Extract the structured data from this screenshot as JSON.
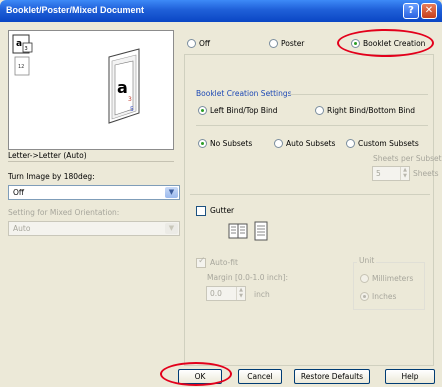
{
  "window": {
    "title": "Booklet/Poster/Mixed Document",
    "help_icon": "?",
    "close_icon": "✕"
  },
  "preview": {
    "caption": "Letter->Letter (Auto)"
  },
  "rotate": {
    "label": "Turn Image by 180deg:",
    "value": "Off"
  },
  "mixed": {
    "label": "Setting for Mixed Orientation:",
    "value": "Auto"
  },
  "mode": {
    "off": "Off",
    "poster": "Poster",
    "booklet": "Booklet Creation",
    "selected": "Booklet Creation"
  },
  "booklet": {
    "group_label": "Booklet Creation Settings",
    "bind_left": "Left Bind/Top Bind",
    "bind_right": "Right Bind/Bottom Bind",
    "no_subsets": "No Subsets",
    "auto_subsets": "Auto Subsets",
    "custom_subsets": "Custom Subsets",
    "sheets_per_subset_label": "Sheets per Subset:",
    "sheets_value": "5",
    "sheets_unit": "Sheets"
  },
  "gutter": {
    "label": "Gutter",
    "autofit": "Auto-fit",
    "margin_label": "Margin [0.0-1.0 inch]:",
    "margin_value": "0.0",
    "margin_unit": "inch",
    "unit_label": "Unit",
    "mm": "Millimeters",
    "inches": "Inches"
  },
  "buttons": {
    "ok": "OK",
    "cancel": "Cancel",
    "restore": "Restore Defaults",
    "help": "Help"
  },
  "colors": {
    "title_bar": "#0a46c4",
    "dialog_bg": "#ece9d8",
    "highlight": "#e3001b",
    "radio_dot": "#2c9e27"
  }
}
